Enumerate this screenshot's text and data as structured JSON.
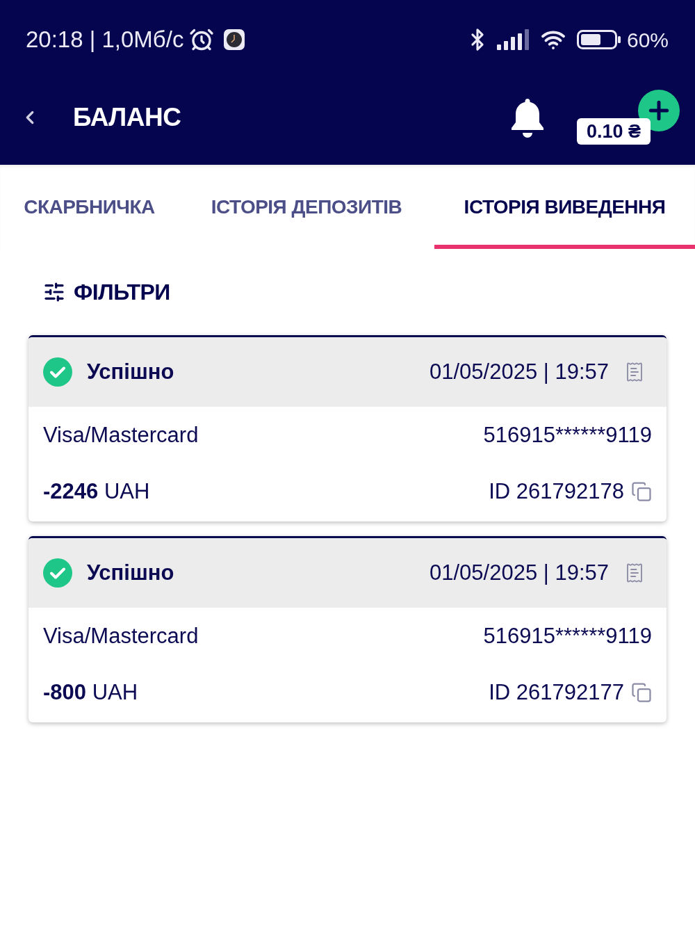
{
  "status_bar": {
    "time_speed": "20:18 | 1,0Мб/с",
    "battery": "60%"
  },
  "header": {
    "title": "БАЛАНС",
    "balance": "0.10 ₴"
  },
  "tabs": [
    {
      "label": "СКАРБНИЧКА",
      "selected": false
    },
    {
      "label": "ІСТОРІЯ ДЕПОЗИТІВ",
      "selected": false
    },
    {
      "label": "ІСТОРІЯ ВИВЕДЕННЯ",
      "selected": true
    }
  ],
  "filters": {
    "label": "ФІЛЬТРИ"
  },
  "transactions": [
    {
      "status": {
        "kind": "success",
        "label": "Успішно"
      },
      "datetime": "01/05/2025 | 19:57",
      "method": "Visa/Mastercard",
      "card": "516915******9119",
      "amount": "**-2246** UAH",
      "id": "ID 261792178"
    },
    {
      "status": {
        "kind": "success",
        "label": "Успішно"
      },
      "datetime": "01/05/2025 | 19:57",
      "method": "Visa/Mastercard",
      "card": "516915******9119",
      "amount": "**-800** UAH",
      "id": "ID 261792177"
    }
  ]
}
